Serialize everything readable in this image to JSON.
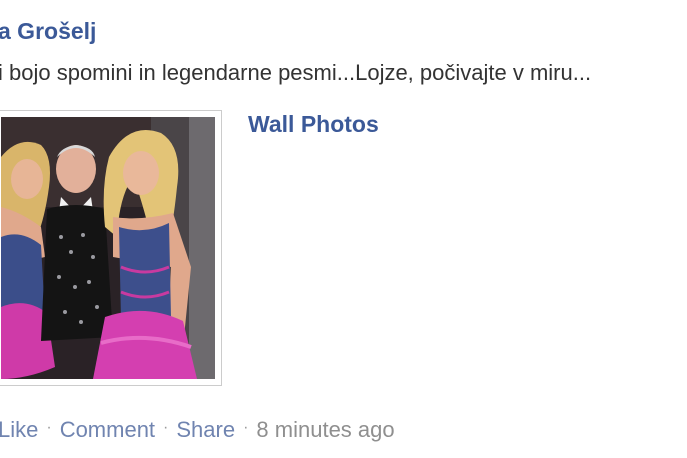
{
  "post": {
    "author": "a Grošelj",
    "message": "i bojo spomini in legendarne pesmi...Lojze, počivajte v miru...",
    "album_link": "Wall Photos",
    "photo": {
      "description_icon": "photo-thumbnail"
    },
    "actions": {
      "like": "Like",
      "comment": "Comment",
      "share": "Share",
      "separator": "·",
      "timestamp": "8 minutes ago"
    }
  }
}
